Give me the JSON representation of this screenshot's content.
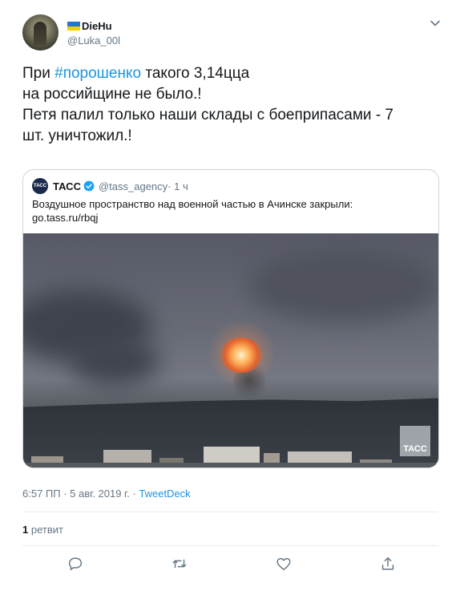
{
  "author": {
    "display_name": "DieHu",
    "handle": "@Luka_00l"
  },
  "tweet": {
    "text_prefix": "При ",
    "hashtag": "#порошенко",
    "text_rest_line1": " такого 3,14цца",
    "line2": "на российщине не было.!",
    "line3": "Петя палил только наши склады с боеприпасами - 7",
    "line4": "шт. уничтожил.!"
  },
  "quote": {
    "logo_text": "ТАСС",
    "name": "ТАСС",
    "handle": "@tass_agency",
    "time": " · 1 ч",
    "text_line1": "Воздушное пространство над военной частью в Ачинске закрыли:",
    "text_line2": "go.tass.ru/rbqj",
    "media_watermark": "ТАСС"
  },
  "meta": {
    "timestamp": "6:57 ПП · 5 авг. 2019 г. · ",
    "source": "TweetDeck"
  },
  "stats": {
    "retweets_count": "1",
    "retweets_label": " ретвит"
  },
  "icons": {
    "reply": "reply-icon",
    "retweet": "retweet-icon",
    "like": "heart-icon",
    "share": "share-icon",
    "caret": "chevron-down-icon",
    "verified": "verified-badge-icon"
  },
  "colors": {
    "accent": "#1b95e0",
    "secondary_text": "#657786",
    "border": "#ccd6dd",
    "flag_blue": "#1f77d4",
    "flag_yellow": "#f5d000"
  }
}
